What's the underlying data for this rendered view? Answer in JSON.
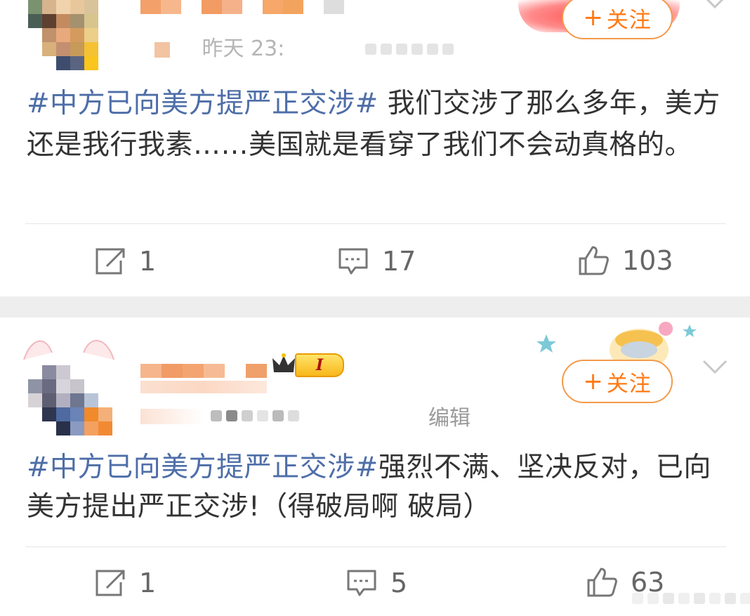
{
  "posts": [
    {
      "follow_label": "关注",
      "follow_plus": "+",
      "topic": "#中方已向美方提严正交涉#",
      "text": " 我们交涉了那么多年，美方还是我行我素……美国就是看穿了我们不会动真格的。",
      "meta_time_partial": "昨天 23:",
      "actions": {
        "repost_count": "1",
        "comment_count": "17",
        "like_count": "103"
      }
    },
    {
      "follow_label": "关注",
      "follow_plus": "+",
      "topic": "#中方已向美方提严正交涉#",
      "text": "强烈不满、坚决反对，已向美方提出严正交涉!（得破局啊 破局）",
      "badge_text": "I",
      "meta_edit": "编辑",
      "actions": {
        "repost_count": "1",
        "comment_count": "5",
        "like_count": "63"
      }
    }
  ],
  "colors": {
    "topic": "#4e6ea8",
    "follow_orange": "#ff7a15",
    "action_gray": "#666666",
    "background_gap": "#eeeeee"
  },
  "icons": [
    "repost-icon",
    "comment-icon",
    "like-icon",
    "chevron-down-icon",
    "crown-icon"
  ]
}
